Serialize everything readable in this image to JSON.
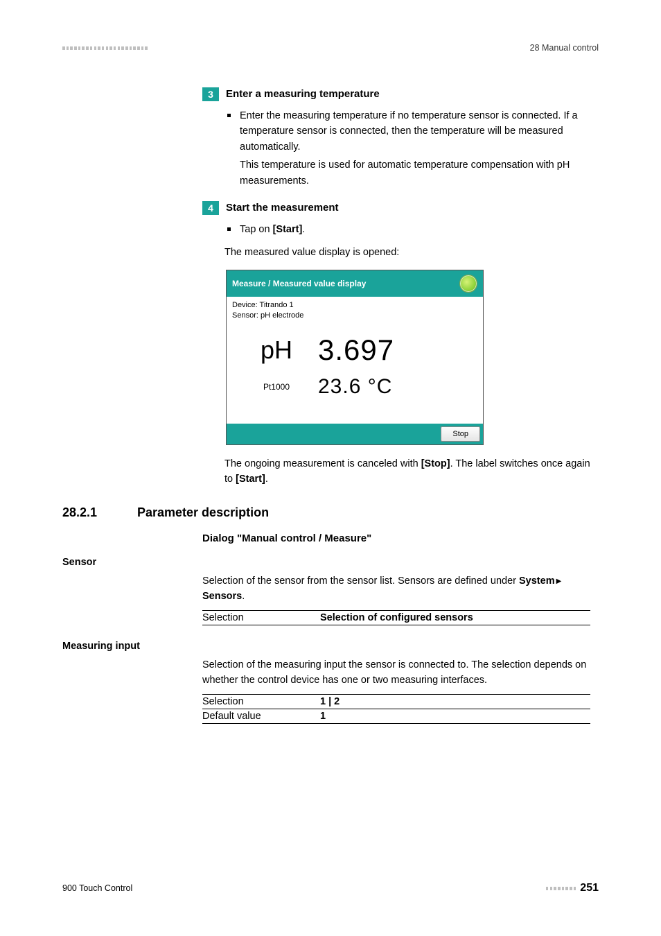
{
  "header": {
    "breadcrumb": "28 Manual control"
  },
  "steps": [
    {
      "num": "3",
      "title": "Enter a measuring temperature",
      "bullets": [
        "Enter the measuring temperature if no temperature sensor is connected. If a temperature sensor is connected, then the temperature will be measured automatically."
      ],
      "sub": "This temperature is used for automatic temperature compensation with pH measurements."
    },
    {
      "num": "4",
      "title": "Start the measurement",
      "bullets_rich": {
        "pre": "Tap on ",
        "btn": "[Start]",
        "post": "."
      },
      "after": "The measured value display is opened:"
    }
  ],
  "device": {
    "title": "Measure / Measured value display",
    "meta1": "Device: Titrando 1",
    "meta2": "Sensor: pH electrode",
    "row1_label": "pH",
    "row1_value": "3.697",
    "row2_label": "Pt1000",
    "row2_value": "23.6 °C",
    "stop": "Stop"
  },
  "after_device": {
    "p1a": "The ongoing measurement is canceled with ",
    "p1b": "[Stop]",
    "p1c": ". The label switches once again to ",
    "p1d": "[Start]",
    "p1e": "."
  },
  "section": {
    "num": "28.2.1",
    "title": "Parameter description",
    "dialog": "Dialog \"Manual control / Measure\""
  },
  "params": {
    "sensor": {
      "name": "Sensor",
      "text_a": "Selection of the sensor from the sensor list. Sensors are defined under ",
      "text_b": "System",
      "text_c": "Sensors",
      "text_d": ".",
      "row_label": "Selection",
      "row_value": "Selection of configured sensors"
    },
    "mi": {
      "name": "Measuring input",
      "text": "Selection of the measuring input the sensor is connected to. The selection depends on whether the control device has one or two measuring interfaces.",
      "r1_label": "Selection",
      "r1_value": "1 | 2",
      "r2_label": "Default value",
      "r2_value": "1"
    }
  },
  "footer": {
    "left": "900 Touch Control",
    "page": "251"
  }
}
